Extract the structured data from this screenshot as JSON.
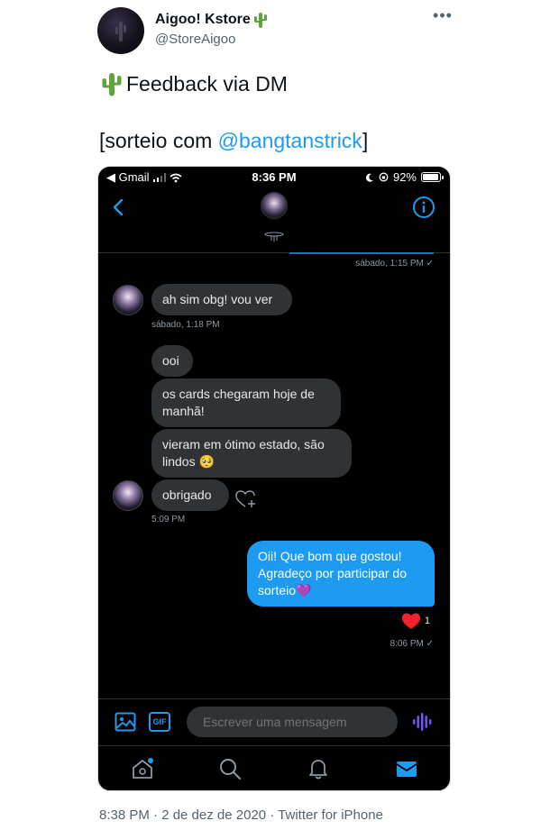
{
  "tweet": {
    "author_name": "Aigoo! Kstore",
    "author_handle": "@StoreAigoo",
    "more_label": "•••",
    "line1": "Feedback via DM",
    "line2_prefix": "[sorteio com ",
    "mention": "@bangtanstrick",
    "line2_suffix": "]",
    "meta": "8:38 PM · 2 de dez de 2020 · Twitter for iPhone"
  },
  "status_bar": {
    "carrier": "◀ Gmail",
    "time": "8:36 PM",
    "battery": "92%"
  },
  "dm": {
    "messages": [
      {
        "from": "them",
        "text": "ah sim obg! vou ver"
      },
      {
        "from": "them",
        "text": "ooi"
      },
      {
        "from": "them",
        "text": "os cards chegaram hoje de manhã!"
      },
      {
        "from": "them",
        "text": "vieram em ótimo estado, são lindos 🥺"
      },
      {
        "from": "them",
        "text": "obrigado"
      },
      {
        "from": "me",
        "text": "Oii! Que bom que gostou! Agradeço por participar do sorteio💜"
      }
    ],
    "timestamps": {
      "top": "sábado, 1:15 PM ✓",
      "after_first": "sábado, 1:18 PM",
      "after_group": "5:09 PM",
      "after_mine": "8:06 PM ✓"
    },
    "reaction": {
      "emoji": "❤",
      "count": "1"
    },
    "input_placeholder": "Escrever uma mensagem",
    "gif_label": "GIF"
  },
  "colors": {
    "accent": "#1d9bf0",
    "bubble_them": "#2f3336",
    "background_dm": "#000000",
    "heart": "#f91880"
  },
  "icons": [
    "back-icon",
    "info-icon",
    "image-icon",
    "gif-icon",
    "voice-icon",
    "home-icon",
    "search-icon",
    "bell-icon",
    "mail-icon",
    "heart-add-icon",
    "cactus-icon"
  ]
}
